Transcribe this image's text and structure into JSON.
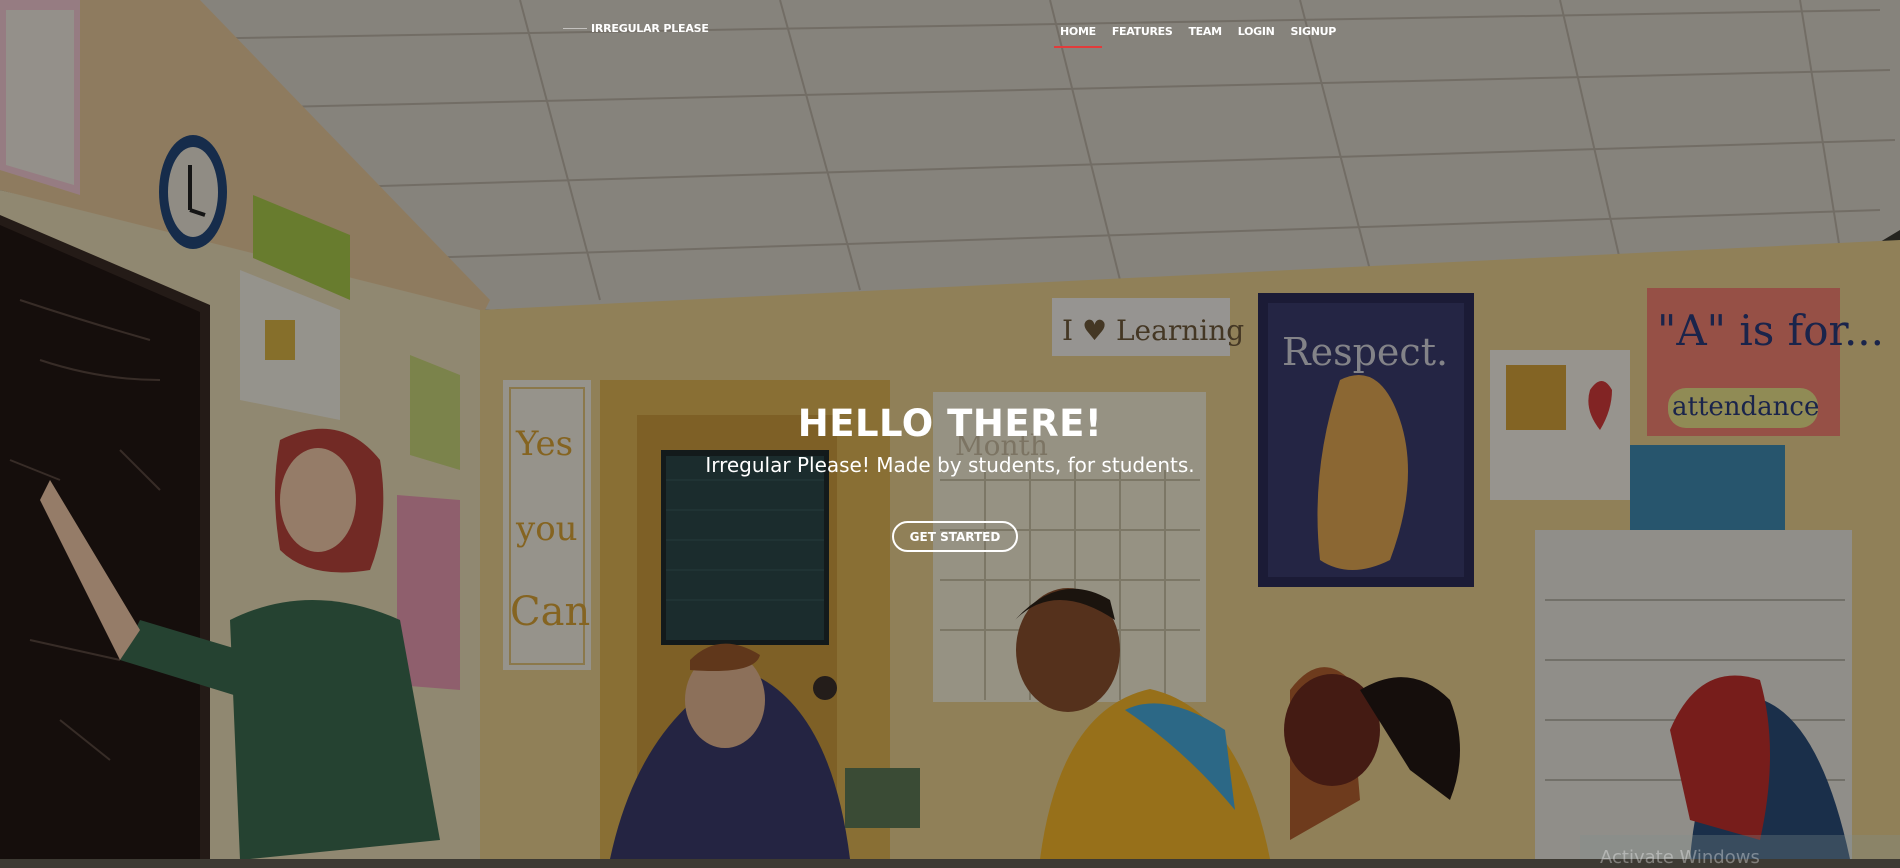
{
  "brand": {
    "name": "IRREGULAR PLEASE"
  },
  "nav": {
    "items": [
      {
        "label": "HOME",
        "active": true
      },
      {
        "label": "FEATURES",
        "active": false
      },
      {
        "label": "TEAM",
        "active": false
      },
      {
        "label": "LOGIN",
        "active": false
      },
      {
        "label": "SIGNUP",
        "active": false
      }
    ]
  },
  "hero": {
    "title": "HELLO THERE!",
    "subtitle": "Irregular Please! Made by students, for students.",
    "cta_label": "GET STARTED"
  },
  "background": {
    "posters": {
      "love_learning": "I ♥ Learning",
      "respect": "Respect.",
      "a_is_for": "\"A\" is for...",
      "attendance": "attendance",
      "yes": "Yes",
      "you": "you",
      "can": "Can",
      "month": "Month"
    }
  },
  "overlay_text": {
    "watermark": "Activate Windows"
  },
  "colors": {
    "accent": "#e23b3b",
    "overlay": "rgba(0,0,0,0.38)"
  }
}
